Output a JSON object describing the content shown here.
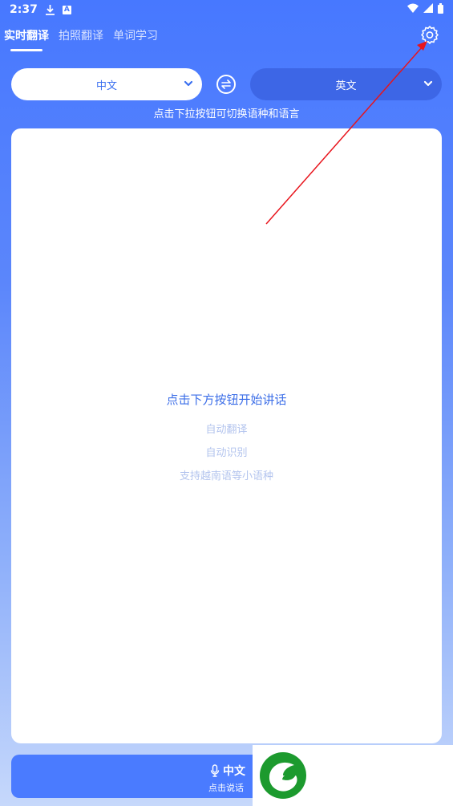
{
  "status_bar": {
    "time": "2:37"
  },
  "tabs": [
    {
      "label": "实时翻译",
      "active": true
    },
    {
      "label": "拍照翻译",
      "active": false
    },
    {
      "label": "单词学习",
      "active": false
    }
  ],
  "languages": {
    "source": "中文",
    "target": "英文"
  },
  "hint": "点击下拉按钮可切换语种和语言",
  "card": {
    "main": "点击下方按钮开始讲话",
    "features": [
      "自动翻译",
      "自动识别",
      "支持越南语等小语种"
    ]
  },
  "speak_button": {
    "language": "中文",
    "hint": "点击说话"
  },
  "colors": {
    "primary": "#4778ff",
    "target_select": "#3d66e6",
    "annotation_arrow": "#e8141c",
    "logo_green": "#1c9a2e"
  }
}
